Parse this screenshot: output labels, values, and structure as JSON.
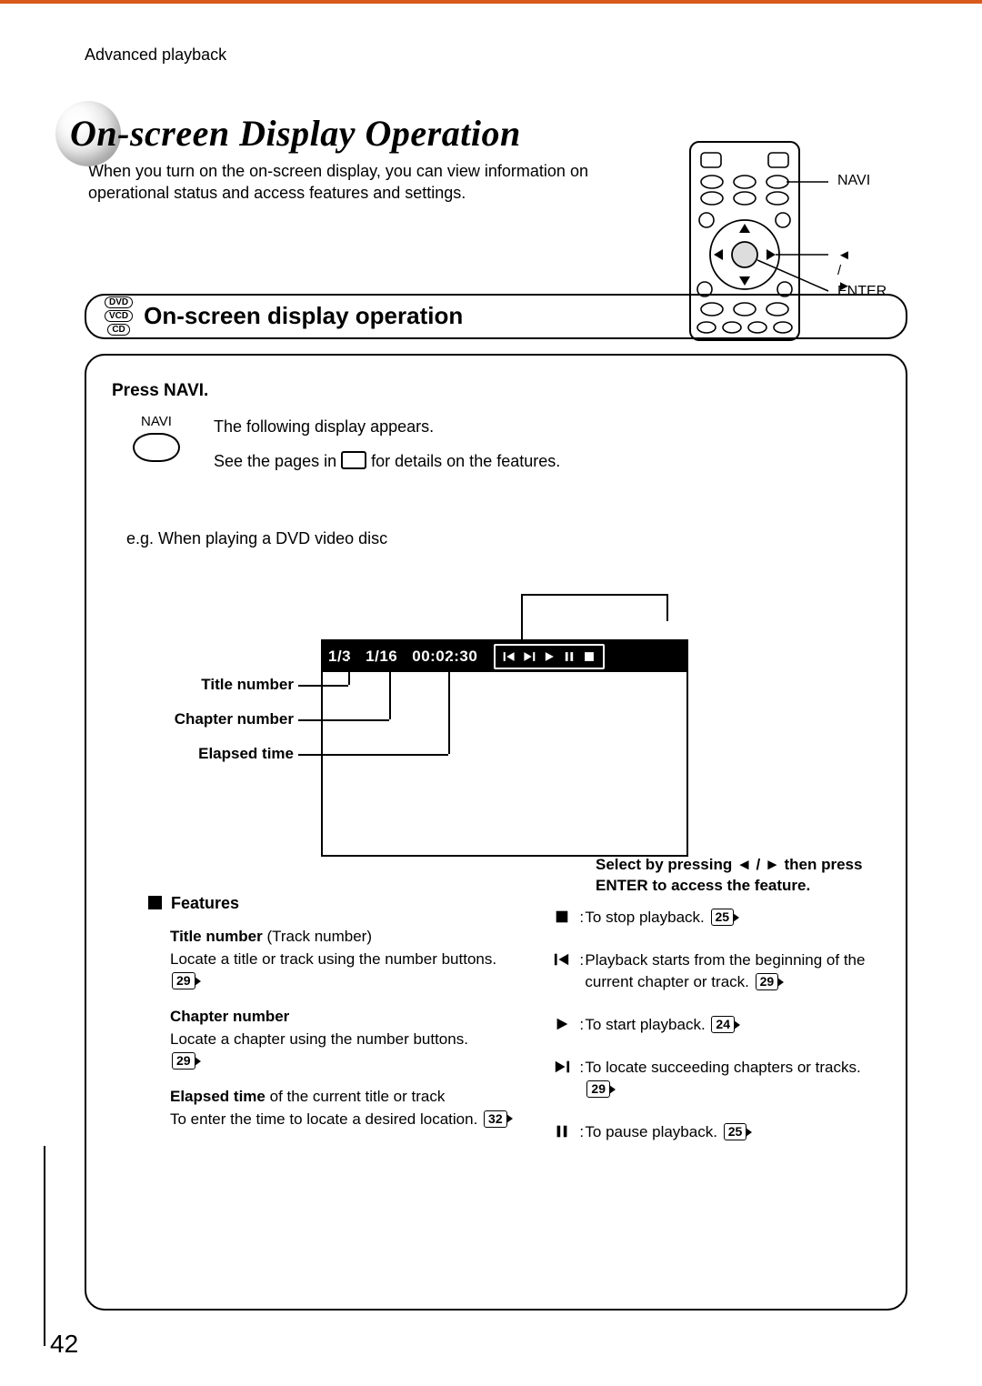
{
  "breadcrumb": "Advanced playback",
  "hero_title": "On-screen Display Operation",
  "intro": "When you turn on the on-screen display, you can view information on operational status and access features and settings.",
  "remote_labels": {
    "navi": "NAVI",
    "arrows": "◄ / ►",
    "enter": "ENTER"
  },
  "media_pills": [
    "DVD",
    "VCD",
    "CD"
  ],
  "section_title": "On-screen display operation",
  "press_title": "Press NAVI.",
  "navi_label": "NAVI",
  "step_line1": "The following display appears.",
  "step_line2a": "See the pages in ",
  "step_line2b": " for details on the features.",
  "eg_line": "e.g. When playing a DVD video disc",
  "osd": {
    "title": "1/3",
    "chapter": "1/16",
    "elapsed": "00:02:30"
  },
  "instr_line1": "Select by pressing ◄ / ► then press",
  "instr_line2": "ENTER  to access the  feature.",
  "callouts": {
    "title": "Title number",
    "chapter": "Chapter number",
    "elapsed": "Elapsed time"
  },
  "features_heading": "Features",
  "features_left": [
    {
      "bold": "Title number ",
      "tail": "(Track number)",
      "body": "Locate a title or track using the number buttons.",
      "ref": "29"
    },
    {
      "bold": "Chapter number",
      "tail": "",
      "body": "Locate a chapter using the number buttons.",
      "ref": "29"
    },
    {
      "bold": "Elapsed time ",
      "tail": "of the current title or track",
      "body": "To enter the time to locate a desired location.",
      "ref": "32"
    }
  ],
  "features_right": [
    {
      "icon": "stop",
      "text": "To stop playback.",
      "ref": "25"
    },
    {
      "icon": "prev",
      "text": "Playback starts from the beginning of the current chapter or track.",
      "ref": "29"
    },
    {
      "icon": "play",
      "text": "To start playback.",
      "ref": "24"
    },
    {
      "icon": "next",
      "text": "To locate succeeding chapters or tracks.",
      "ref": "29"
    },
    {
      "icon": "pause",
      "text": "To pause playback.",
      "ref": "25"
    }
  ],
  "page_number": "42"
}
